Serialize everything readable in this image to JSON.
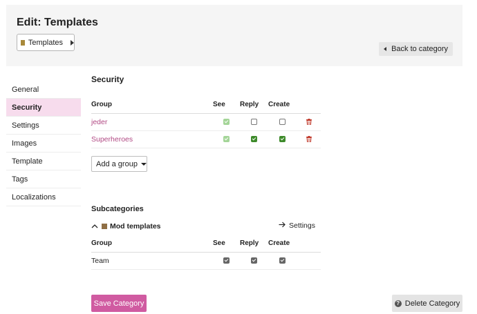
{
  "header": {
    "title": "Edit: Templates",
    "category_chooser": {
      "label": "Templates",
      "color": "#a8893a"
    },
    "back_label": "Back to category"
  },
  "sidebar": {
    "items": [
      {
        "label": "General"
      },
      {
        "label": "Security",
        "active": true
      },
      {
        "label": "Settings"
      },
      {
        "label": "Images"
      },
      {
        "label": "Template"
      },
      {
        "label": "Tags"
      },
      {
        "label": "Localizations"
      }
    ]
  },
  "security": {
    "title": "Security",
    "columns": [
      "Group",
      "See",
      "Reply",
      "Create"
    ],
    "rows": [
      {
        "group": "jeder",
        "see": "checked-disabled",
        "reply": "unchecked",
        "create": "unchecked"
      },
      {
        "group": "Superheroes",
        "see": "checked-disabled",
        "reply": "checked",
        "create": "checked"
      }
    ],
    "add_group_label": "Add a group"
  },
  "subcategories": {
    "title": "Subcategories",
    "name": "Mod templates",
    "swatch_color": "#8f6f45",
    "settings_label": "Settings",
    "columns": [
      "Group",
      "See",
      "Reply",
      "Create"
    ],
    "rows": [
      {
        "group": "Team",
        "see": "checked",
        "reply": "checked",
        "create": "checked"
      }
    ]
  },
  "footer": {
    "save_label": "Save Category",
    "delete_label": "Delete Category"
  },
  "colors": {
    "primary": "#d05ba1",
    "link": "#b14a84",
    "check_green": "#3d8a2a",
    "check_light": "#a4d598",
    "danger": "#c0392b",
    "sidebar_active": "#f7dced"
  }
}
